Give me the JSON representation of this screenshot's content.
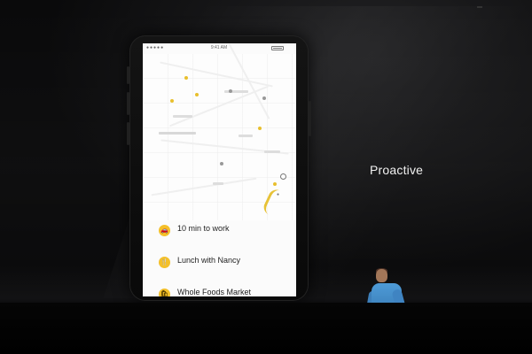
{
  "slide": {
    "heading": "Proactive",
    "phone": {
      "status_time": "9:41 AM",
      "suggestions": [
        {
          "icon_name": "car-icon",
          "label": "10 min to work"
        },
        {
          "icon_name": "utensils-icon",
          "label": "Lunch with Nancy"
        },
        {
          "icon_name": "shopping-bag-icon",
          "label": "Whole Foods Market"
        }
      ]
    },
    "colors": {
      "accent_yellow": "#f4c02a",
      "presenter_shirt": "#4e9bd7",
      "background": "#050505"
    }
  }
}
